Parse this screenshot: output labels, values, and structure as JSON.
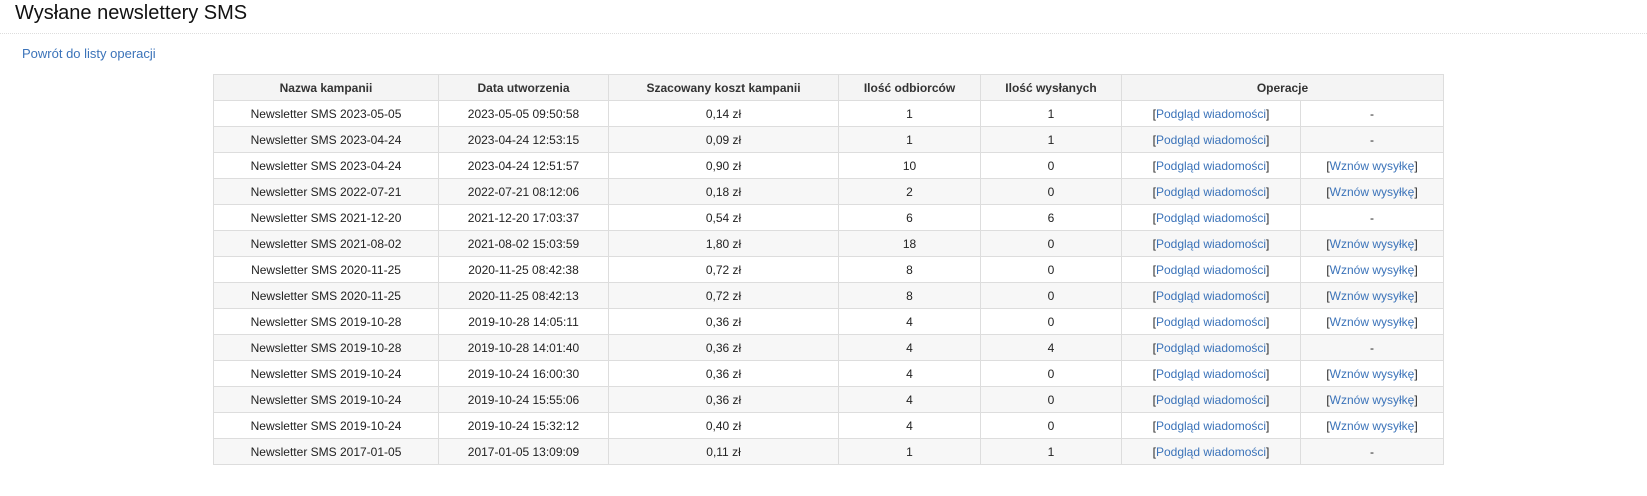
{
  "page": {
    "title": "Wysłane newslettery SMS",
    "back_link": "Powrót do listy operacji"
  },
  "table": {
    "headers": {
      "name": "Nazwa kampanii",
      "created": "Data utworzenia",
      "cost": "Szacowany koszt kampanii",
      "recipients": "Ilość odbiorców",
      "sent": "Ilość wysłanych",
      "operations": "Operacje"
    },
    "preview_label": "Podgląd wiadomości",
    "resume_label": "Wznów wysyłkę",
    "rows": [
      {
        "name": "Newsletter SMS 2023-05-05",
        "created": "2023-05-05 09:50:58",
        "cost": "0,14 zł",
        "recipients": "1",
        "sent": "1",
        "resume": false
      },
      {
        "name": "Newsletter SMS 2023-04-24",
        "created": "2023-04-24 12:53:15",
        "cost": "0,09 zł",
        "recipients": "1",
        "sent": "1",
        "resume": false
      },
      {
        "name": "Newsletter SMS 2023-04-24",
        "created": "2023-04-24 12:51:57",
        "cost": "0,90 zł",
        "recipients": "10",
        "sent": "0",
        "resume": true
      },
      {
        "name": "Newsletter SMS 2022-07-21",
        "created": "2022-07-21 08:12:06",
        "cost": "0,18 zł",
        "recipients": "2",
        "sent": "0",
        "resume": true
      },
      {
        "name": "Newsletter SMS 2021-12-20",
        "created": "2021-12-20 17:03:37",
        "cost": "0,54 zł",
        "recipients": "6",
        "sent": "6",
        "resume": false
      },
      {
        "name": "Newsletter SMS 2021-08-02",
        "created": "2021-08-02 15:03:59",
        "cost": "1,80 zł",
        "recipients": "18",
        "sent": "0",
        "resume": true
      },
      {
        "name": "Newsletter SMS 2020-11-25",
        "created": "2020-11-25 08:42:38",
        "cost": "0,72 zł",
        "recipients": "8",
        "sent": "0",
        "resume": true
      },
      {
        "name": "Newsletter SMS 2020-11-25",
        "created": "2020-11-25 08:42:13",
        "cost": "0,72 zł",
        "recipients": "8",
        "sent": "0",
        "resume": true
      },
      {
        "name": "Newsletter SMS 2019-10-28",
        "created": "2019-10-28 14:05:11",
        "cost": "0,36 zł",
        "recipients": "4",
        "sent": "0",
        "resume": true
      },
      {
        "name": "Newsletter SMS 2019-10-28",
        "created": "2019-10-28 14:01:40",
        "cost": "0,36 zł",
        "recipients": "4",
        "sent": "4",
        "resume": false
      },
      {
        "name": "Newsletter SMS 2019-10-24",
        "created": "2019-10-24 16:00:30",
        "cost": "0,36 zł",
        "recipients": "4",
        "sent": "0",
        "resume": true
      },
      {
        "name": "Newsletter SMS 2019-10-24",
        "created": "2019-10-24 15:55:06",
        "cost": "0,36 zł",
        "recipients": "4",
        "sent": "0",
        "resume": true
      },
      {
        "name": "Newsletter SMS 2019-10-24",
        "created": "2019-10-24 15:32:12",
        "cost": "0,40 zł",
        "recipients": "4",
        "sent": "0",
        "resume": true
      },
      {
        "name": "Newsletter SMS 2017-01-05",
        "created": "2017-01-05 13:09:09",
        "cost": "0,11 zł",
        "recipients": "1",
        "sent": "1",
        "resume": false
      }
    ]
  },
  "colors": {
    "link": "#3b73b9",
    "border": "#dddddd",
    "header_bg": "#f4f4f4",
    "row_alt_bg": "#f7f7f7"
  }
}
